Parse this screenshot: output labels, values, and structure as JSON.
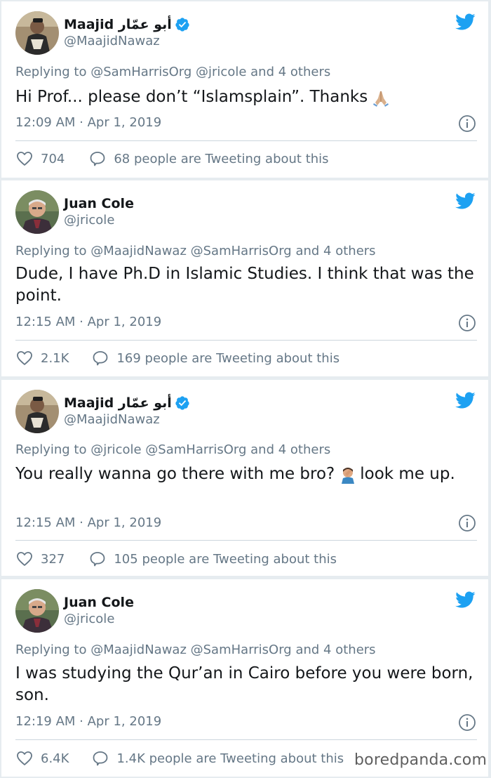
{
  "tweets": [
    {
      "name": "Maajid أبو عمّار",
      "handle": "@MaajidNawaz",
      "verified": true,
      "reply_to": "Replying to @SamHarrisOrg @jricole and 4 others",
      "text": "Hi Prof... please don’t “Islamsplain”. Thanks",
      "emoji": "folded-hands",
      "timestamp": "12:09 AM · Apr 1, 2019",
      "likes": "704",
      "conversation": "68 people are Tweeting about this"
    },
    {
      "name": "Juan Cole",
      "handle": "@jricole",
      "verified": false,
      "reply_to": "Replying to @MaajidNawaz @SamHarrisOrg and 4 others",
      "text": "Dude, I have  Ph.D in Islamic Studies.  I think that was the point.",
      "timestamp": "12:15 AM · Apr 1, 2019",
      "likes": "2.1K",
      "conversation": "169 people are Tweeting about this"
    },
    {
      "name": "Maajid أبو عمّار",
      "handle": "@MaajidNawaz",
      "verified": true,
      "reply_to": "Replying to @jricole @SamHarrisOrg and 4 others",
      "text_before": "You really wanna go there with me bro?",
      "emoji": "man-facepalming",
      "text_after": "look me up.",
      "timestamp": "12:15 AM · Apr 1, 2019",
      "likes": "327",
      "conversation": "105 people are Tweeting about this"
    },
    {
      "name": "Juan Cole",
      "handle": "@jricole",
      "verified": false,
      "reply_to": "Replying to @MaajidNawaz @SamHarrisOrg and 4 others",
      "text": "I was studying the Qur’an in Cairo before you were born, son.",
      "timestamp": "12:19 AM · Apr 1, 2019",
      "likes": "6.4K",
      "conversation": "1.4K people are Tweeting about this"
    }
  ],
  "icons": {
    "brand": "twitter-bird-icon",
    "info": "info-icon",
    "like": "heart-icon",
    "conversation": "speech-bubble-icon",
    "verified": "verified-badge-icon"
  },
  "colors": {
    "twitter_blue": "#1da1f2",
    "text_primary": "#14171a",
    "text_secondary": "#657786",
    "background": "#e6ecf0"
  },
  "watermark": "boredpanda.com"
}
